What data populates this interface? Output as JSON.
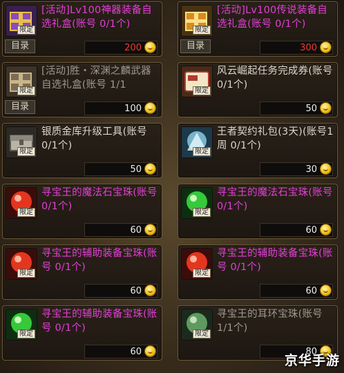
{
  "limit_tag": "限定",
  "menu_label": "目录",
  "watermark": "京华手游",
  "items": [
    {
      "name": "[活动]Lv100神器装备自选礼盒(账号 0/1个)",
      "price": "200",
      "price_color": "red",
      "has_menu": true,
      "name_color": "mag",
      "icon": "gift-box-purple-icon"
    },
    {
      "name": "[活动]Lv100传说装备自选礼盒(账号 0/1个)",
      "price": "300",
      "price_color": "red",
      "has_menu": true,
      "name_color": "mag",
      "icon": "gift-box-orange-icon"
    },
    {
      "name": "[活动]胜・深渊之麟武器自选礼盒(账号 1/1",
      "price": "100",
      "price_color": "white",
      "has_menu": true,
      "name_color": "gray",
      "icon": "gift-box-gray-icon"
    },
    {
      "name": "风云崛起任务完成券(账号 0/1个)",
      "price": "50",
      "price_color": "white",
      "has_menu": false,
      "name_color": "white",
      "icon": "ticket-icon"
    },
    {
      "name": "银质金库升级工具(账号 0/1个)",
      "price": "50",
      "price_color": "white",
      "has_menu": false,
      "name_color": "white",
      "icon": "chest-icon"
    },
    {
      "name": "王者契约礼包(3天)(账号1周 0/1个)",
      "price": "30",
      "price_color": "white",
      "has_menu": false,
      "name_color": "white",
      "icon": "contract-icon"
    },
    {
      "name": "寻宝王的魔法石宝珠(账号 0/1个)",
      "price": "60",
      "price_color": "white",
      "has_menu": false,
      "name_color": "mag",
      "icon": "red-orb-icon"
    },
    {
      "name": "寻宝王的魔法石宝珠(账号 0/1个)",
      "price": "60",
      "price_color": "white",
      "has_menu": false,
      "name_color": "mag",
      "icon": "green-orb-icon"
    },
    {
      "name": "寻宝王的辅助装备宝珠(账号 0/1个)",
      "price": "60",
      "price_color": "white",
      "has_menu": false,
      "name_color": "mag",
      "icon": "red-orb-icon"
    },
    {
      "name": "寻宝王的辅助装备宝珠(账号 0/1个)",
      "price": "60",
      "price_color": "white",
      "has_menu": false,
      "name_color": "mag",
      "icon": "red-orb-icon"
    },
    {
      "name": "寻宝王的辅助装备宝珠(账号 0/1个)",
      "price": "60",
      "price_color": "white",
      "has_menu": false,
      "name_color": "mag",
      "icon": "green-orb-icon"
    },
    {
      "name": "寻宝王的耳环宝珠(账号 1/1个)",
      "price": "80",
      "price_color": "white",
      "has_menu": false,
      "name_color": "gray",
      "icon": "green-orb-icon"
    }
  ]
}
